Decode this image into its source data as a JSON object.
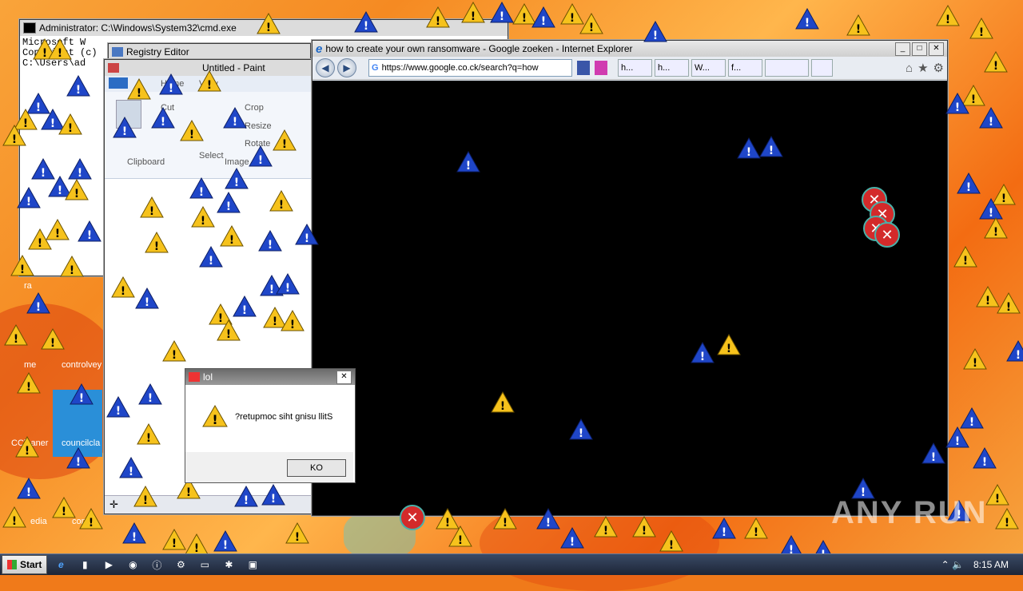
{
  "colors": {
    "desktop": "#f58a22",
    "ie_bg": "#000000",
    "warn_yellow": "#f6c21c",
    "warn_blue": "#1f46c8",
    "error_red": "#d32a2a"
  },
  "cmd": {
    "title": "Administrator: C:\\Windows\\System32\\cmd.exe",
    "line1": "Microsoft W    ",
    "line2": "Copyright (c)",
    "line3": "C:\\Users\\ad"
  },
  "regedit": {
    "title": "Registry Editor"
  },
  "paint": {
    "title": "Untitled - Paint",
    "tab_home": "Home",
    "tab_view": "View",
    "cut": "Cut",
    "crop": "Crop",
    "resize": "Resize",
    "select": "Select",
    "rotate": "Rotate",
    "clipboard": "Clipboard",
    "image": "Image"
  },
  "ie": {
    "title": "how to create your own ransomware - Google zoeken - Internet Explorer",
    "address": "https://www.google.co.ck/search?q=how",
    "tabs": [
      "h...",
      "h...",
      "W...",
      "f..."
    ]
  },
  "dialog": {
    "title": "lol",
    "message": "?retupmoc siht gnisu llitS",
    "ok": "KO"
  },
  "desktop_icons": {
    "icon1": "ra",
    "icon2": "controlvey",
    "icon3": "me",
    "icon4": "CCleaner",
    "icon5": "councilcla",
    "icon6": "edia",
    "icon7": "contal"
  },
  "taskbar": {
    "start": "Start",
    "time": "8:15 AM"
  },
  "watermark": "ANY RUN",
  "icons": {
    "warning": "warning-icon",
    "error": "error-icon"
  }
}
